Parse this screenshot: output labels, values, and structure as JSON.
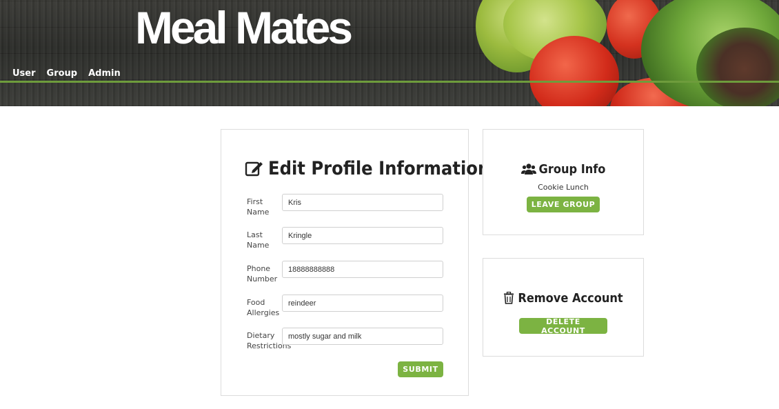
{
  "header": {
    "brand": "Meal Mates",
    "nav": [
      {
        "label": "User"
      },
      {
        "label": "Group"
      },
      {
        "label": "Admin"
      }
    ],
    "accent_line_color": "#6e9c3c"
  },
  "profile_form": {
    "title": "Edit Profile Information",
    "icon": "edit-icon",
    "fields": [
      {
        "label": "First Name",
        "value": "Kris"
      },
      {
        "label": "Last Name",
        "value": "Kringle"
      },
      {
        "label": "Phone Number",
        "value": "18888888888"
      },
      {
        "label": "Food Allergies",
        "value": "reindeer"
      },
      {
        "label": "Dietary Restrictions",
        "value": "mostly sugar and milk"
      }
    ],
    "submit_label": "SUBMIT"
  },
  "group_info": {
    "title": "Group Info",
    "icon": "users-icon",
    "group_name": "Cookie Lunch",
    "leave_label": "LEAVE GROUP"
  },
  "remove_account": {
    "title": "Remove Account",
    "icon": "trash-icon",
    "delete_label": "DELETE ACCOUNT"
  },
  "colors": {
    "button": "#7cb342",
    "text": "#222222"
  }
}
